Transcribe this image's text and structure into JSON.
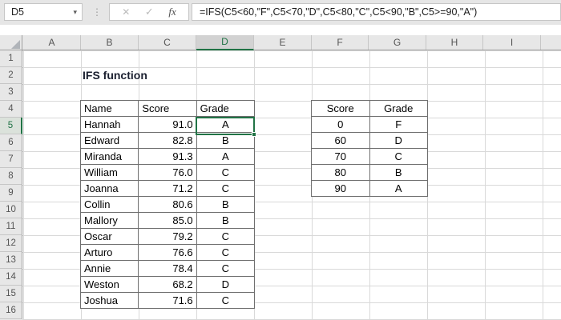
{
  "formula_bar": {
    "cell_reference": "D5",
    "dropdown_icon": "▾",
    "separator_icon": "⋮",
    "cancel_icon": "✕",
    "enter_icon": "✓",
    "fx_label": "fx",
    "formula": "=IFS(C5<60,\"F\",C5<70,\"D\",C5<80,\"C\",C5<90,\"B\",C5>=90,\"A\")"
  },
  "sheet": {
    "title": "IFS function",
    "selected_cell": "D5",
    "column_headers": [
      "A",
      "B",
      "C",
      "D",
      "E",
      "F",
      "G",
      "H",
      "I"
    ],
    "row_headers": [
      "1",
      "2",
      "3",
      "4",
      "5",
      "6",
      "7",
      "8",
      "9",
      "10",
      "11",
      "12",
      "13",
      "14",
      "15",
      "16"
    ]
  },
  "main_table": {
    "headers": [
      "Name",
      "Score",
      "Grade"
    ],
    "rows": [
      {
        "name": "Hannah",
        "score": "91.0",
        "grade": "A"
      },
      {
        "name": "Edward",
        "score": "82.8",
        "grade": "B"
      },
      {
        "name": "Miranda",
        "score": "91.3",
        "grade": "A"
      },
      {
        "name": "William",
        "score": "76.0",
        "grade": "C"
      },
      {
        "name": "Joanna",
        "score": "71.2",
        "grade": "C"
      },
      {
        "name": "Collin",
        "score": "80.6",
        "grade": "B"
      },
      {
        "name": "Mallory",
        "score": "85.0",
        "grade": "B"
      },
      {
        "name": "Oscar",
        "score": "79.2",
        "grade": "C"
      },
      {
        "name": "Arturo",
        "score": "76.6",
        "grade": "C"
      },
      {
        "name": "Annie",
        "score": "78.4",
        "grade": "C"
      },
      {
        "name": "Weston",
        "score": "68.2",
        "grade": "D"
      },
      {
        "name": "Joshua",
        "score": "71.6",
        "grade": "C"
      }
    ]
  },
  "lookup_table": {
    "headers": [
      "Score",
      "Grade"
    ],
    "rows": [
      {
        "score": "0",
        "grade": "F"
      },
      {
        "score": "60",
        "grade": "D"
      },
      {
        "score": "70",
        "grade": "C"
      },
      {
        "score": "80",
        "grade": "B"
      },
      {
        "score": "90",
        "grade": "A"
      }
    ]
  },
  "colors": {
    "accent_green": "#217346",
    "main_header_fill": "#d9e1f2",
    "lookup_header_fill": "#e2efda"
  }
}
